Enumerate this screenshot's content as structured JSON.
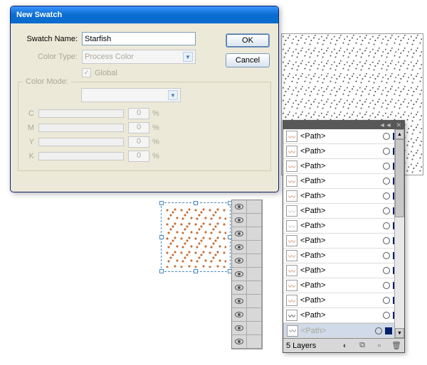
{
  "dialog": {
    "title": "New Swatch",
    "swatch_name_label": "Swatch Name:",
    "swatch_name_value": "Starfish",
    "color_type_label": "Color Type:",
    "color_type_value": "Process Color",
    "global_label": "Global",
    "color_mode_label": "Color Mode:",
    "c_label": "C",
    "m_label": "M",
    "y_label": "Y",
    "k_label": "K",
    "c_val": "0",
    "m_val": "0",
    "y_val": "0",
    "k_val": "0",
    "pct": "%",
    "ok": "OK",
    "cancel": "Cancel"
  },
  "layers": {
    "items": [
      {
        "name": "<Path>"
      },
      {
        "name": "<Path>"
      },
      {
        "name": "<Path>"
      },
      {
        "name": "<Path>"
      },
      {
        "name": "<Path>"
      },
      {
        "name": "<Path>"
      },
      {
        "name": "<Path>"
      },
      {
        "name": "<Path>"
      },
      {
        "name": "<Path>"
      },
      {
        "name": "<Path>"
      },
      {
        "name": "<Path>"
      },
      {
        "name": "<Path>"
      },
      {
        "name": "<Path>"
      },
      {
        "name": "<Path>"
      }
    ],
    "footer_count": "5 Layers"
  }
}
